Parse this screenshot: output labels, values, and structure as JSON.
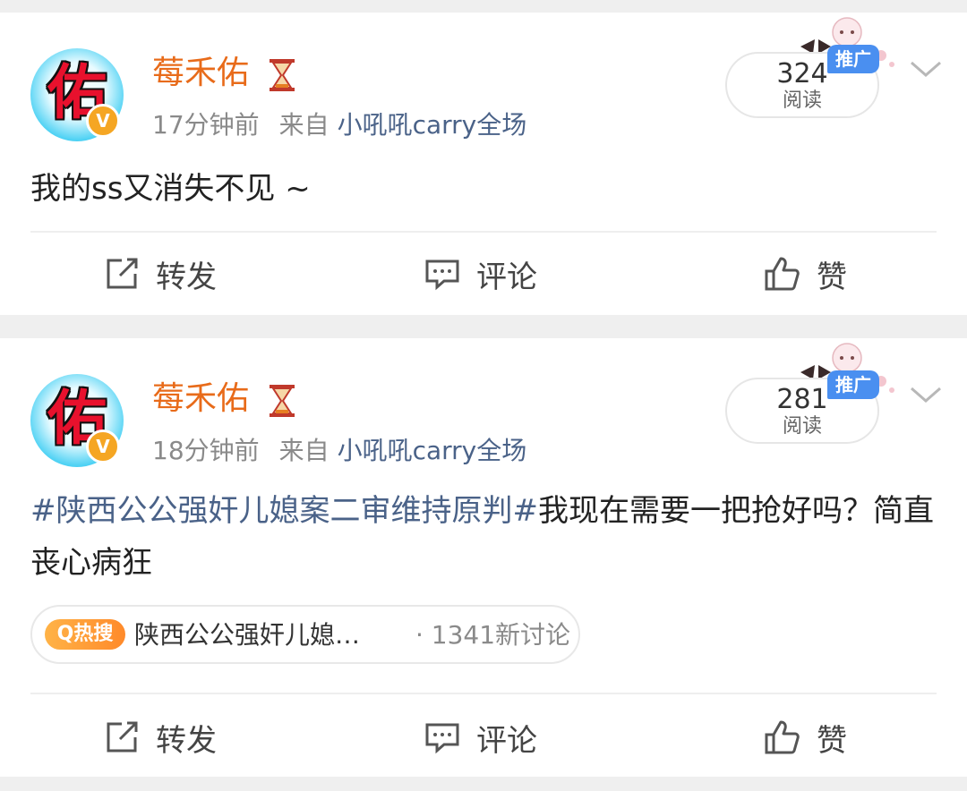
{
  "posts": [
    {
      "avatar_char": "佑",
      "verified_mark": "V",
      "username": "莓禾佑",
      "time": "17分钟前",
      "source_prefix": "来自",
      "source": "小吼吼carry全场",
      "read_count": "324",
      "read_label": "阅读",
      "promo_label": "推广",
      "content": "我的ss又消失不见 ~",
      "actions": {
        "share": "转发",
        "comment": "评论",
        "like": "赞"
      }
    },
    {
      "avatar_char": "佑",
      "verified_mark": "V",
      "username": "莓禾佑",
      "time": "18分钟前",
      "source_prefix": "来自",
      "source": "小吼吼carry全场",
      "read_count": "281",
      "read_label": "阅读",
      "promo_label": "推广",
      "content_topic": "#陕西公公强奸儿媳案二审维持原判#",
      "content_rest": "我现在需要一把抢好吗？简直丧心病狂",
      "hot_badge": "Q热搜",
      "hot_topic": "陕西公公强奸儿媳…",
      "hot_count": "· 1341新讨论",
      "actions": {
        "share": "转发",
        "comment": "评论",
        "like": "赞"
      }
    }
  ],
  "colors": {
    "username": "#e86b1a",
    "link": "#4a6288",
    "promo": "#4a8ff0",
    "hot": "#ff8a2a"
  },
  "icons": [
    "hourglass-icon",
    "chevron-down-icon",
    "share-icon",
    "comment-icon",
    "like-icon",
    "verified-badge-icon",
    "hot-search-icon"
  ]
}
